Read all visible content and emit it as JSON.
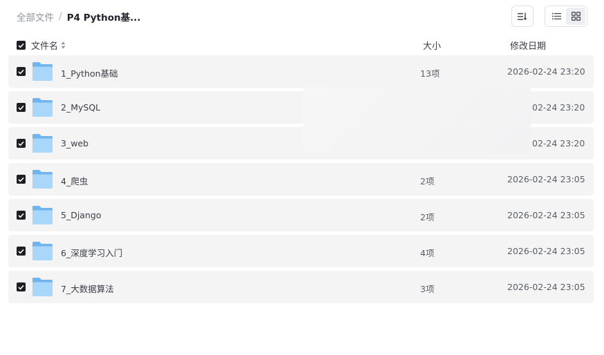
{
  "breadcrumb": {
    "root": "全部文件",
    "separator": "/",
    "current": "P4 Python基..."
  },
  "table": {
    "headers": {
      "name": "文件名",
      "size": "大小",
      "date": "修改日期"
    },
    "rows": [
      {
        "name": "1_Python基础",
        "size": "13项",
        "date": "2026-02-24 23:20"
      },
      {
        "name": "2_MySQL",
        "size": "",
        "date": "02-24 23:20"
      },
      {
        "name": "3_web",
        "size": "",
        "date": "02-24 23:20"
      },
      {
        "name": "4_爬虫",
        "size": "2项",
        "date": "2026-02-24 23:05"
      },
      {
        "name": "5_Django",
        "size": "2项",
        "date": "2026-02-24 23:05"
      },
      {
        "name": "6_深度学习入门",
        "size": "4项",
        "date": "2026-02-24 23:05"
      },
      {
        "name": "7_大数据算法",
        "size": "3项",
        "date": "2026-02-24 23:05"
      }
    ]
  },
  "icons": {
    "sort": "sort-icon",
    "list_view": "list-view-icon",
    "grid_view": "grid-view-icon",
    "folder": "folder-icon",
    "check": "check-icon"
  },
  "colors": {
    "row_bg": "#f4f4f5",
    "checkbox": "#1d1f24",
    "folder_back": "#6fb3ef",
    "folder_front": "#a9d6fb"
  }
}
